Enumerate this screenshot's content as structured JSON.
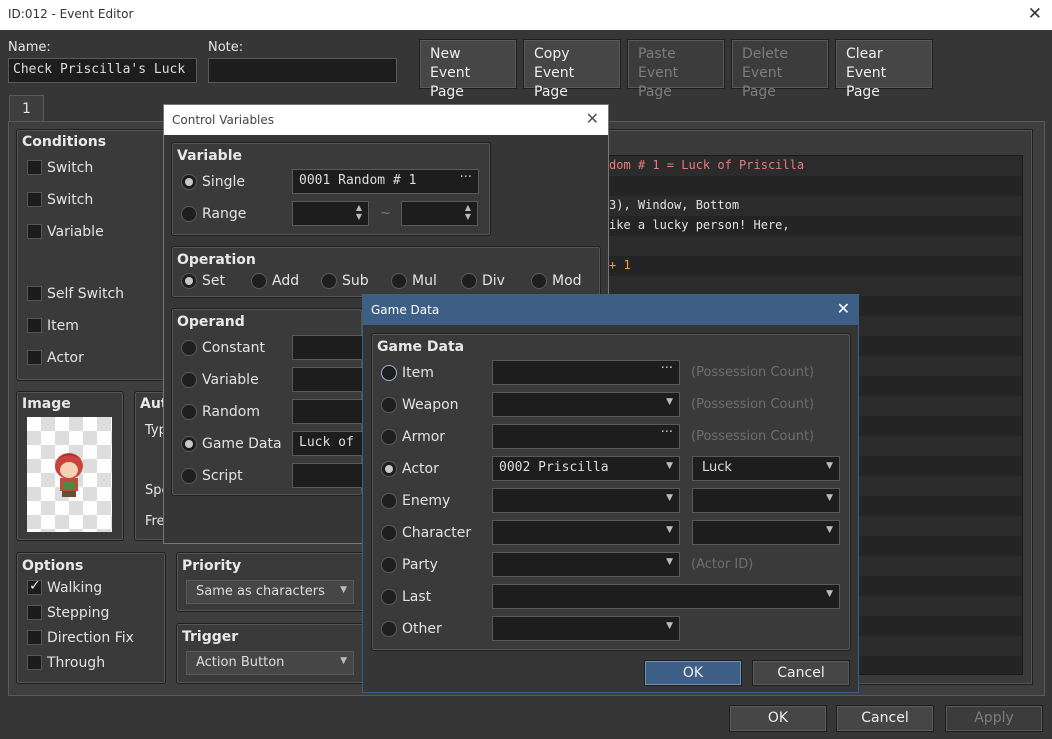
{
  "window": {
    "title": "ID:012 - Event Editor"
  },
  "header": {
    "name_label": "Name:",
    "name_value": "Check Priscilla's Luck",
    "note_label": "Note:",
    "note_value": "",
    "buttons": [
      {
        "line1": "New",
        "line2": "Event Page",
        "enabled": true
      },
      {
        "line1": "Copy",
        "line2": "Event Page",
        "enabled": true
      },
      {
        "line1": "Paste",
        "line2": "Event Page",
        "enabled": false
      },
      {
        "line1": "Delete",
        "line2": "Event Page",
        "enabled": false
      },
      {
        "line1": "Clear",
        "line2": "Event Page",
        "enabled": true
      }
    ]
  },
  "page_tab": "1",
  "conditions": {
    "title": "Conditions",
    "items": [
      "Switch",
      "Switch",
      "Variable",
      "Self Switch",
      "Item",
      "Actor"
    ]
  },
  "image": {
    "title": "Image"
  },
  "autonomous": {
    "title": "Aut",
    "type": "Typ",
    "speed": "Spe",
    "freq": "Fre"
  },
  "options": {
    "title": "Options",
    "items": [
      {
        "label": "Walking",
        "checked": true
      },
      {
        "label": "Stepping",
        "checked": false
      },
      {
        "label": "Direction Fix",
        "checked": false
      },
      {
        "label": "Through",
        "checked": false
      }
    ]
  },
  "priority": {
    "title": "Priority",
    "value": "Same as characters"
  },
  "trigger": {
    "title": "Trigger",
    "value": "Action Button"
  },
  "code": [
    {
      "text": "dom # 1 = Luck of Priscilla",
      "color": "#e87b7b"
    },
    {
      "text": "",
      "color": "#ddd"
    },
    {
      "text": "3), Window, Bottom",
      "color": "#e3e3e3"
    },
    {
      "text": "ike a lucky person! Here,",
      "color": "#e3e3e3"
    },
    {
      "text": "",
      "color": "#ddd"
    },
    {
      "text": "+ 1",
      "color": "#e8a14a"
    }
  ],
  "footer": {
    "ok": "OK",
    "cancel": "Cancel",
    "apply": "Apply"
  },
  "control_variables": {
    "title": "Control Variables",
    "variable": {
      "title": "Variable",
      "single": "Single",
      "range": "Range",
      "single_value": "0001 Random # 1",
      "tilde": "~"
    },
    "operation": {
      "title": "Operation",
      "items": [
        "Set",
        "Add",
        "Sub",
        "Mul",
        "Div",
        "Mod"
      ]
    },
    "operand": {
      "title": "Operand",
      "items": [
        "Constant",
        "Variable",
        "Random",
        "Game Data",
        "Script"
      ],
      "game_data_value": "Luck of P"
    }
  },
  "game_data": {
    "title": "Game Data",
    "group_title": "Game Data",
    "rows": [
      {
        "label": "Item",
        "hint": "(Possession Count)"
      },
      {
        "label": "Weapon",
        "hint": "(Possession Count)"
      },
      {
        "label": "Armor",
        "hint": "(Possession Count)"
      },
      {
        "label": "Actor",
        "value": "0002 Priscilla",
        "param": "Luck"
      },
      {
        "label": "Enemy"
      },
      {
        "label": "Character"
      },
      {
        "label": "Party",
        "hint": "(Actor ID)"
      },
      {
        "label": "Last"
      },
      {
        "label": "Other"
      }
    ],
    "ok": "OK",
    "cancel": "Cancel"
  },
  "icons": {
    "close": "close-icon",
    "check": "check-icon",
    "dropdown": "chevron-down-icon",
    "ellipsis": "ellipsis-icon"
  },
  "colors": {
    "accent": "#3d5f86",
    "title_active": "#3d5f86"
  }
}
